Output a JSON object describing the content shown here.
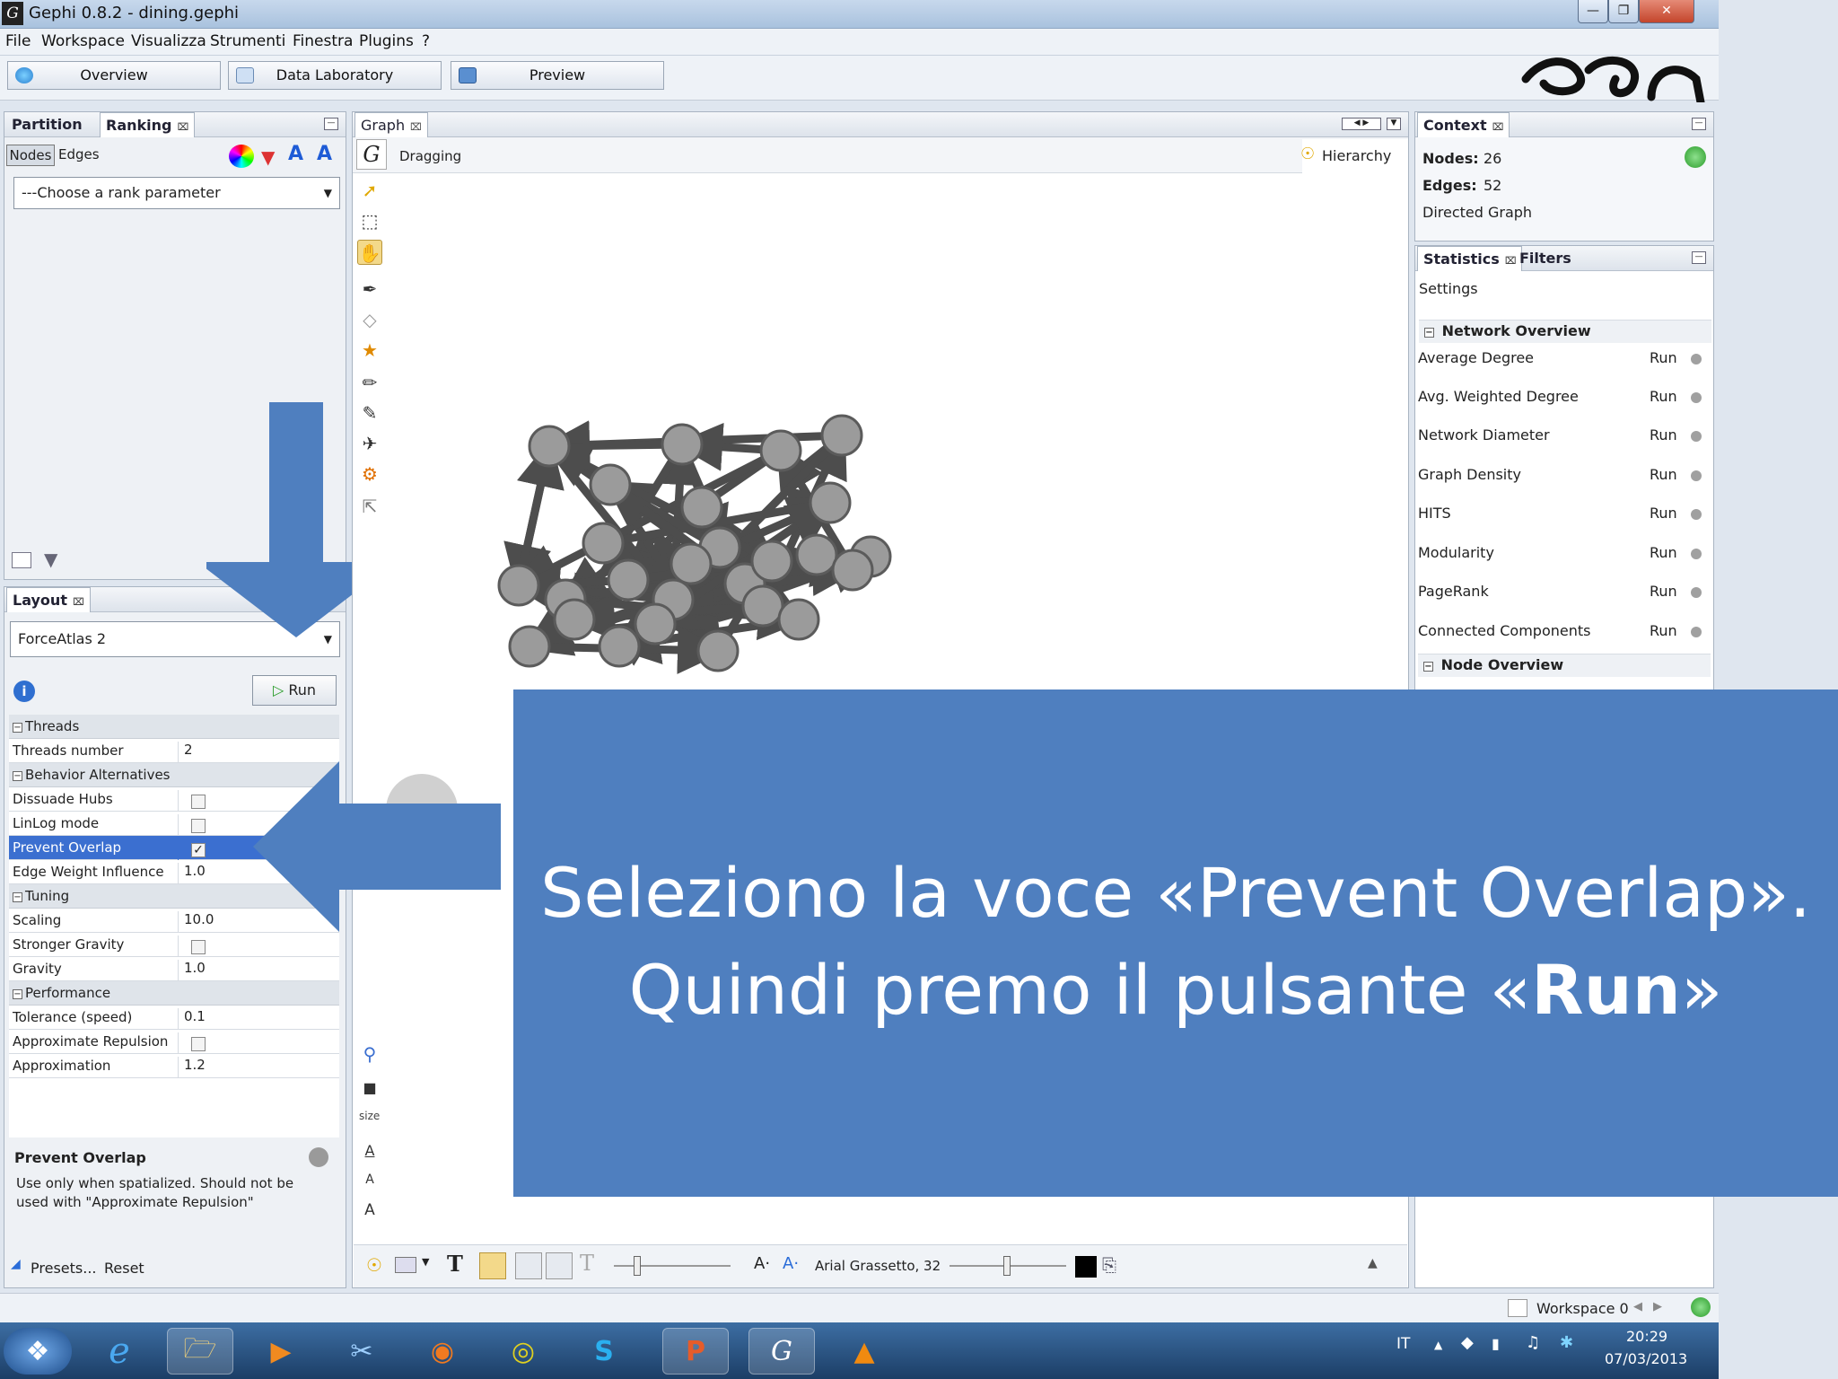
{
  "window": {
    "title": "Gephi 0.8.2 - dining.gephi",
    "app_icon": "G"
  },
  "menu": [
    "File",
    "Workspace",
    "Visualizza",
    "Strumenti",
    "Finestra",
    "Plugins",
    "?"
  ],
  "modes": {
    "overview": "Overview",
    "data_lab": "Data Laboratory",
    "preview": "Preview"
  },
  "left_panel": {
    "tabs": {
      "partition": "Partition",
      "ranking": "Ranking"
    },
    "subtabs": {
      "nodes": "Nodes",
      "edges": "Edges"
    },
    "rank_placeholder": "---Choose a rank parameter"
  },
  "layout": {
    "tab": "Layout",
    "algorithm": "ForceAtlas 2",
    "run_label": "Run",
    "properties": {
      "threads": "Threads",
      "threads_number": {
        "label": "Threads number",
        "value": "2"
      },
      "behavior": "Behavior Alternatives",
      "dissuade_hubs": "Dissuade Hubs",
      "linlog": "LinLog mode",
      "prevent_overlap": "Prevent Overlap",
      "edge_weight": {
        "label": "Edge Weight Influence",
        "value": "1.0"
      },
      "tuning": "Tuning",
      "scaling": {
        "label": "Scaling",
        "value": "10.0"
      },
      "stronger_gravity": "Stronger Gravity",
      "gravity": {
        "label": "Gravity",
        "value": "1.0"
      },
      "performance": "Performance",
      "tolerance": {
        "label": "Tolerance (speed)",
        "value": "0.1"
      },
      "approx_repulsion": "Approximate Repulsion",
      "approximation": {
        "label": "Approximation",
        "value": "1.2"
      }
    },
    "desc_title": "Prevent Overlap",
    "desc_text": "Use only when spatialized. Should not be used with \"Approximate Repulsion\"",
    "presets": "Presets...",
    "reset": "Reset"
  },
  "graph": {
    "tab": "Graph",
    "mode_label": "Dragging",
    "hierarchy": "Hierarchy",
    "size_label": "size",
    "font_label": "Arial Grassetto, 32"
  },
  "context": {
    "tab": "Context",
    "nodes_label": "Nodes:",
    "nodes": "26",
    "edges_label": "Edges:",
    "edges": "52",
    "graph_type": "Directed Graph"
  },
  "statistics": {
    "tabs": {
      "statistics": "Statistics",
      "filters": "Filters"
    },
    "settings": "Settings",
    "network_overview": "Network Overview",
    "items": [
      "Average Degree",
      "Avg. Weighted Degree",
      "Network Diameter",
      "Graph Density",
      "HITS",
      "Modularity",
      "PageRank",
      "Connected Components"
    ],
    "run": "Run",
    "node_overview": "Node Overview"
  },
  "statusbar": {
    "workspace": "Workspace 0"
  },
  "taskbar": {
    "lang": "IT",
    "time": "20:29",
    "date": "07/03/2013"
  },
  "overlay": {
    "line1": "Seleziono la voce «Prevent Overlap».",
    "line2_pre": "Quindi premo il pulsante «",
    "line2_bold": "Run",
    "line2_post": "»"
  },
  "graph_canvas": {
    "node_count_shown": 26
  }
}
